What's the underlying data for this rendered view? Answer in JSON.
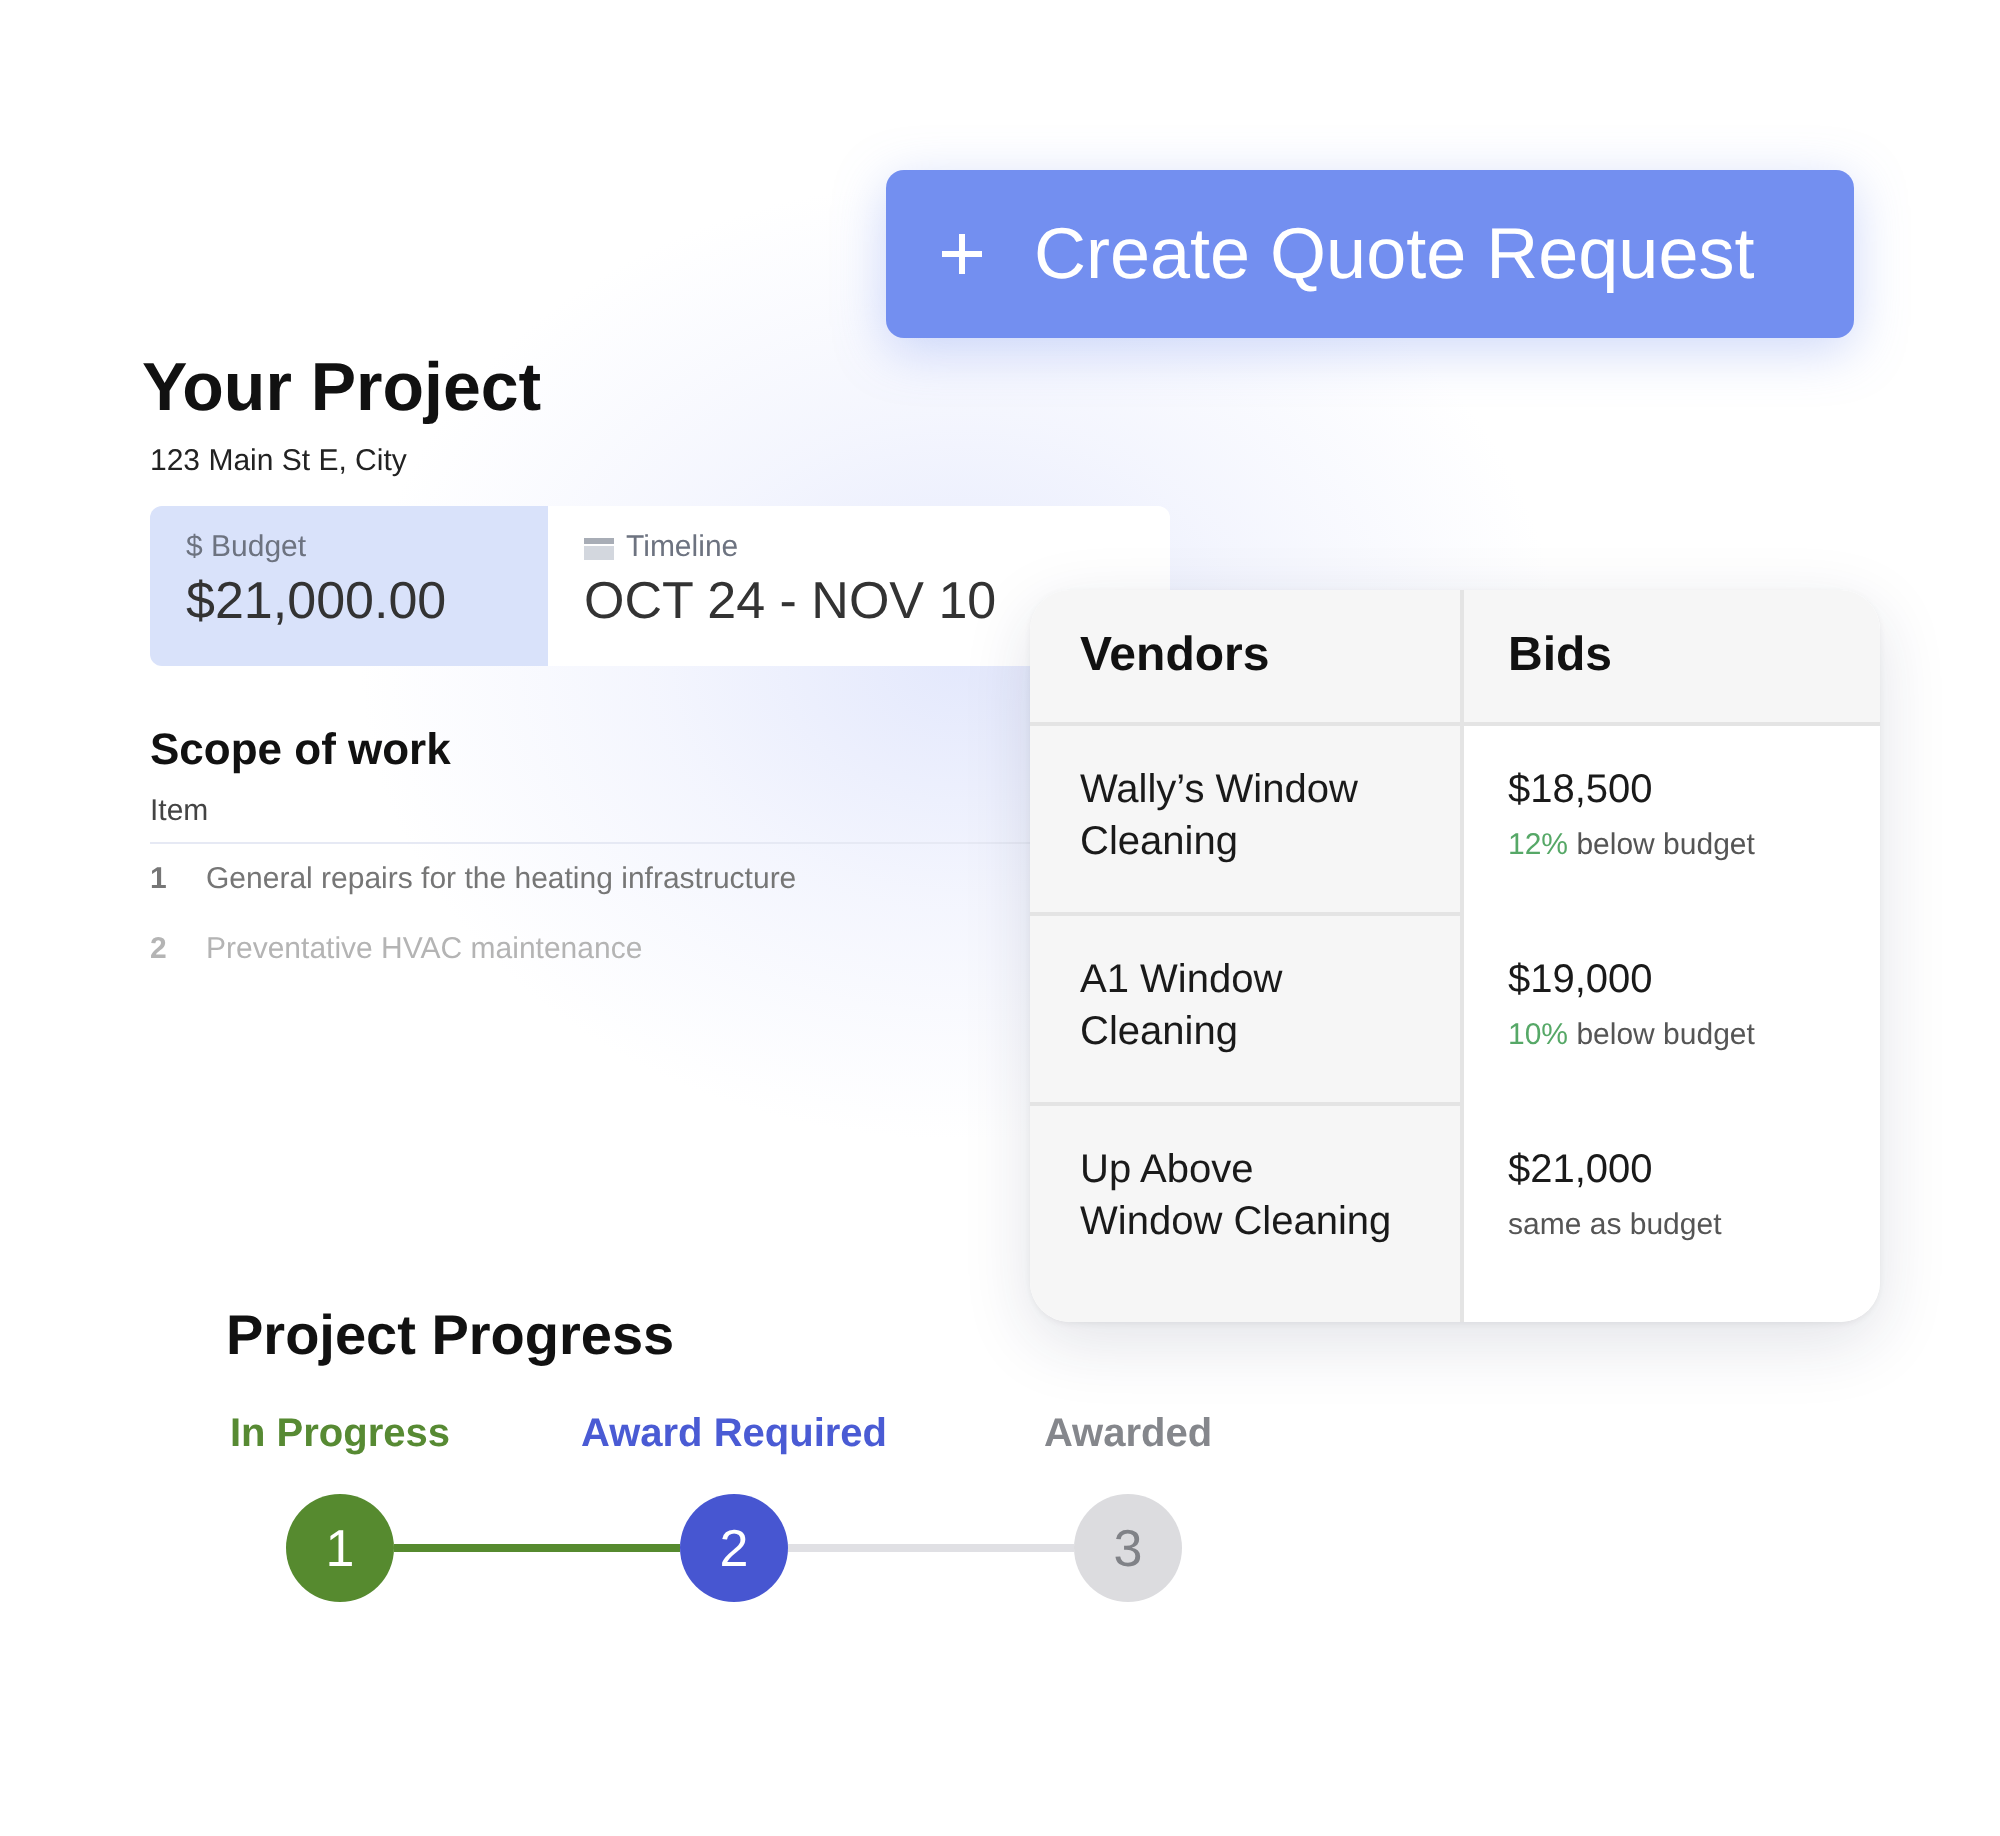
{
  "action_button": {
    "label": "Create Quote Request"
  },
  "project": {
    "title": "Your Project",
    "address": "123 Main St E, City",
    "budget": {
      "label": "$ Budget",
      "value": "$21,000.00"
    },
    "timeline": {
      "label": "Timeline",
      "value": "OCT 24 - NOV 10"
    }
  },
  "scope": {
    "title": "Scope of work",
    "column": "Item",
    "items": [
      {
        "number": "1",
        "text": "General repairs for the heating infrastructure"
      },
      {
        "number": "2",
        "text": "Preventative HVAC maintenance"
      }
    ]
  },
  "bids_table": {
    "columns": [
      "Vendors",
      "Bids"
    ],
    "rows": [
      {
        "vendor": "Wally’s Window Cleaning",
        "amount": "$18,500",
        "percent": "12%",
        "note": "below budget"
      },
      {
        "vendor": "A1 Window Cleaning",
        "amount": "$19,000",
        "percent": "10%",
        "note": "below budget"
      },
      {
        "vendor": "Up Above Window Cleaning",
        "amount": "$21,000",
        "note": "same as budget"
      }
    ]
  },
  "progress": {
    "title": "Project Progress",
    "steps": [
      {
        "label": "In Progress",
        "number": "1",
        "completed": true,
        "selected": false
      },
      {
        "label": "Award Required",
        "number": "2",
        "completed": false,
        "selected": true
      },
      {
        "label": "Awarded",
        "number": "3",
        "completed": false,
        "selected": false
      }
    ]
  }
}
